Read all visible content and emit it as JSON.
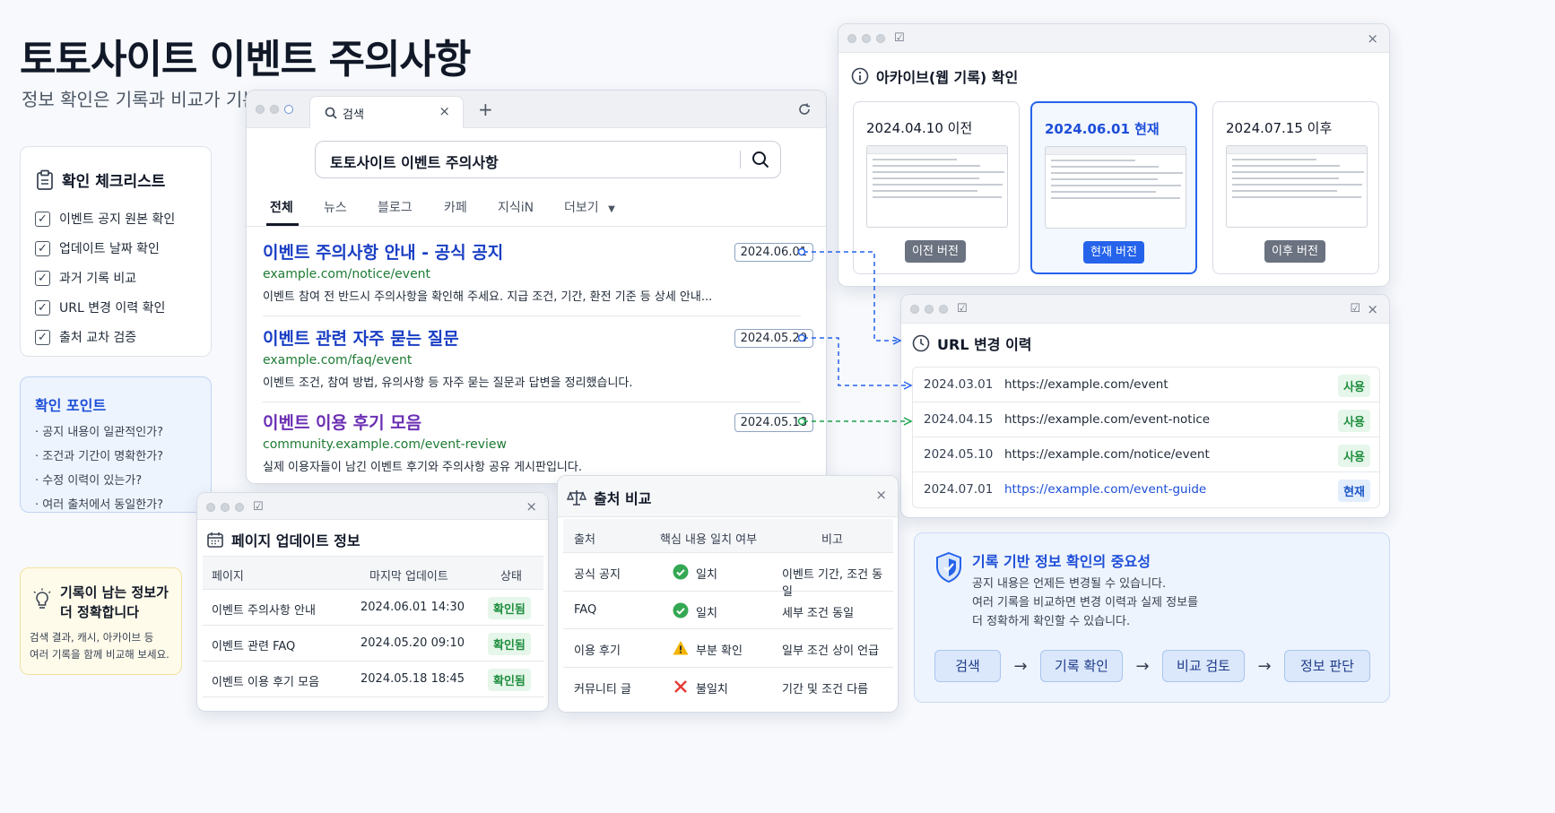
{
  "header": {
    "title": "토토사이트 이벤트 주의사항",
    "subtitle": "정보 확인은 기록과 비교가 기본입니다"
  },
  "checklist": {
    "title": "확인 체크리스트",
    "items": [
      "이벤트 공지 원본 확인",
      "업데이트 날짜 확인",
      "과거 기록 비교",
      "URL 변경 이력 확인",
      "출처 교차 검증"
    ]
  },
  "points": {
    "title": "확인 포인트",
    "items": [
      "· 공지 내용이 일관적인가?",
      "· 조건과 기간이 명확한가?",
      "· 수정 이력이 있는가?",
      "· 여러 출처에서 동일한가?"
    ]
  },
  "tip": {
    "title_line1": "기록이 남는 정보가",
    "title_line2": "더 정확합니다",
    "body_line1": "검색 결과, 캐시, 아카이브 등",
    "body_line2": "여러 기록을 함께 비교해 보세요."
  },
  "browser": {
    "tab_label": "검색",
    "new_tab": "+",
    "query": "토토사이트 이벤트 주의사항",
    "tabs": [
      "전체",
      "뉴스",
      "블로그",
      "카페",
      "지식iN",
      "더보기"
    ],
    "results": [
      {
        "title": "이벤트 주의사항 안내 - 공식 공지",
        "url": "example.com/notice/event",
        "snippet": "이벤트 참여 전 반드시 주의사항을 확인해 주세요. 지급 조건, 기간, 환전 기준 등 상세 안내...",
        "date": "2024.06.01"
      },
      {
        "title": "이벤트 관련 자주 묻는 질문",
        "url": "example.com/faq/event",
        "snippet": "이벤트 조건, 참여 방법, 유의사항 등 자주 묻는 질문과 답변을 정리했습니다.",
        "date": "2024.05.20"
      },
      {
        "title": "이벤트 이용 후기 모음",
        "url": "community.example.com/event-review",
        "snippet": "실제 이용자들이 남긴 이벤트 후기와 주의사항 공유 게시판입니다.",
        "date": "2024.05.18"
      }
    ]
  },
  "archive": {
    "title": "아카이브(웹 기록) 확인",
    "versions": [
      {
        "date": "2024.04.10 이전",
        "button": "이전 버전"
      },
      {
        "date": "2024.06.01 현재",
        "button": "현재 버전"
      },
      {
        "date": "2024.07.15 이후",
        "button": "이후 버전"
      }
    ]
  },
  "url_history": {
    "title": "URL 변경 이력",
    "rows": [
      {
        "date": "2024.03.01",
        "url": "https://example.com/event",
        "status": "사용"
      },
      {
        "date": "2024.04.15",
        "url": "https://example.com/event-notice",
        "status": "사용"
      },
      {
        "date": "2024.05.10",
        "url": "https://example.com/notice/event",
        "status": "사용"
      },
      {
        "date": "2024.07.01",
        "url": "https://example.com/event-guide",
        "status": "현재"
      }
    ]
  },
  "updates": {
    "title": "페이지 업데이트 정보",
    "headers": [
      "페이지",
      "마지막 업데이트",
      "상태"
    ],
    "rows": [
      {
        "page": "이벤트 주의사항 안내",
        "updated": "2024.06.01 14:30",
        "status": "확인됨"
      },
      {
        "page": "이벤트 관련 FAQ",
        "updated": "2024.05.20 09:10",
        "status": "확인됨"
      },
      {
        "page": "이벤트 이용 후기 모음",
        "updated": "2024.05.18 18:45",
        "status": "확인됨"
      }
    ]
  },
  "compare": {
    "title": "출처 비교",
    "headers": [
      "출처",
      "핵심 내용 일치 여부",
      "비고"
    ],
    "rows": [
      {
        "source": "공식 공지",
        "icon": "check-icon",
        "match": "일치",
        "note": "이벤트 기간, 조건 동일"
      },
      {
        "source": "FAQ",
        "icon": "check-icon",
        "match": "일치",
        "note": "세부 조건 동일"
      },
      {
        "source": "이용 후기",
        "icon": "warning-icon",
        "match": "부분 확인",
        "note": "일부 조건 상이 언급"
      },
      {
        "source": "커뮤니티 글",
        "icon": "cross-icon",
        "match": "불일치",
        "note": "기간 및 조건 다름"
      }
    ]
  },
  "importance": {
    "title": "기록 기반 정보 확인의 중요성",
    "body": [
      "공지 내용은 언제든 변경될 수 있습니다.",
      "여러 기록을 비교하면 변경 이력과 실제 정보를",
      "더 정확하게 확인할 수 있습니다."
    ],
    "steps": [
      "검색",
      "기록 확인",
      "비교 검토",
      "정보 판단"
    ]
  },
  "colors": {
    "link_blue": "#1a3fc4",
    "visited_purple": "#6b2fb3",
    "url_green": "#1e7b34",
    "accent_blue": "#2563eb"
  }
}
